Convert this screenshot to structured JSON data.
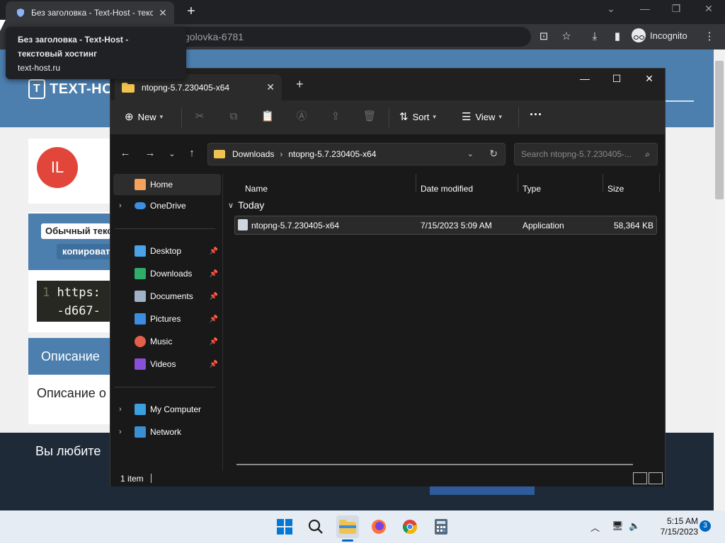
{
  "browser": {
    "tab_title": "Без заголовка - Text-Host - текс",
    "new_tab": "+",
    "address_partial": "golovka-6781",
    "incognito_label": "Incognito",
    "tooltip": {
      "title_line1": "Без заголовка - Text-Host -",
      "title_line2": "текстовый хостинг",
      "domain": "text-host.ru"
    },
    "controls": {
      "minimize": "—",
      "restore": "❐",
      "close": "✕",
      "dropdown": "⌄"
    }
  },
  "webpage": {
    "logo_text": "TEXT-HOST R",
    "logo_mark": "T",
    "avatar_initials": "IL",
    "badge_plain": "Обычный текст",
    "badge_copy": "копировать",
    "code_line_number": "1",
    "code_line1": "https:",
    "code_line2": "-d667-",
    "description_heading": "Описание",
    "description_body": "Описание о",
    "footer_text": "Вы любите"
  },
  "explorer": {
    "tab_title": "ntopng-5.7.230405-x64",
    "commands": {
      "new": "New",
      "sort": "Sort",
      "view": "View",
      "more": "···"
    },
    "address": {
      "segments": [
        "Downloads",
        "ntopng-5.7.230405-x64"
      ]
    },
    "search_placeholder": "Search ntopng-5.7.230405-...",
    "sidebar": {
      "home": "Home",
      "onedrive": "OneDrive",
      "desktop": "Desktop",
      "downloads": "Downloads",
      "documents": "Documents",
      "pictures": "Pictures",
      "music": "Music",
      "videos": "Videos",
      "my_computer": "My Computer",
      "network": "Network"
    },
    "columns": {
      "name": "Name",
      "date_modified": "Date modified",
      "type": "Type",
      "size": "Size"
    },
    "group_label": "Today",
    "files": [
      {
        "name": "ntopng-5.7.230405-x64",
        "date": "7/15/2023 5:09 AM",
        "type": "Application",
        "size": "58,364 KB"
      }
    ],
    "status_count": "1 item"
  },
  "taskbar": {
    "time": "5:15 AM",
    "date": "7/15/2023",
    "notifications": "3"
  },
  "colors": {
    "site_blue": "#4c7fae",
    "folder_yellow": "#f0c350",
    "avatar_red": "#e2463b",
    "taskbar_accent": "#0067c0"
  }
}
